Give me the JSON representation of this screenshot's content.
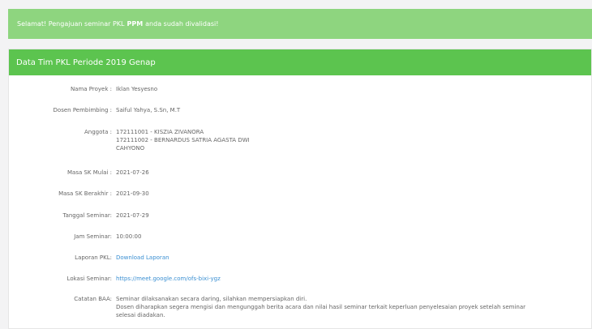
{
  "alert": {
    "prefix": "Selamat! Pengajuan seminar PKL",
    "highlight": "PPM",
    "suffix": "anda sudah divalidasi!"
  },
  "panel": {
    "title": "Data Tim PKL Periode 2019 Genap"
  },
  "details": [
    {
      "label": "Nama Proyek :",
      "value": "Iklan Yesyesno"
    },
    {
      "label": "Dosen Pembimbing :",
      "value": "Saiful Yahya, S.Sn, M.T"
    },
    {
      "label": "Anggota :",
      "lines": [
        "172111001 - KISZIA ZIVANORA",
        "172111002 - BERNARDUS SATRIA AGASTA DWI",
        "CAHYONO"
      ]
    },
    {
      "label": "Masa SK Mulai :",
      "value": "2021-07-26"
    },
    {
      "label": "Masa SK Berakhir :",
      "value": "2021-09-30"
    },
    {
      "label": "Tanggal Seminar:",
      "value": "2021-07-29"
    },
    {
      "label": "Jam Seminar:",
      "value": "10:00:00"
    },
    {
      "label": "Laporan PKL:",
      "link": "Download Laporan"
    },
    {
      "label": "Lokasi Seminar:",
      "link": "https://meet.google.com/ofs-bixi-ygz"
    },
    {
      "label": "Catatan BAA:",
      "lines": [
        "Seminar dilaksanakan secara daring, silahkan mempersiapkan diri.",
        "Dosen diharapkan segera mengisi dan mengunggah berita acara dan nilai hasil seminar terkait keperluan penyelesaian proyek setelah seminar",
        "selesai diadakan."
      ]
    }
  ]
}
